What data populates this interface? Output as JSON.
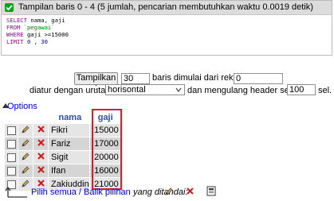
{
  "status": {
    "message": "Tampilan baris 0 - 4 (5 jumlah, pencarian membutuhkan waktu 0.0019 detik)",
    "success_icon": "check-icon"
  },
  "sql": {
    "select_kw": "SELECT",
    "select_cols": " nama, gaji",
    "from_kw": "FROM",
    "from_table": " `pegawai`",
    "where_kw": "WHERE",
    "where_cond": " gaji >=15000",
    "limit_kw": "LIMIT",
    "limit_vals": " 0 , 30"
  },
  "controls": {
    "show_button": "Tampilkan :",
    "rows_value": "30",
    "rows_from_label": "baris dimulai dari rekord #",
    "start_value": "0",
    "order_label": "diatur dengan urutan",
    "order_selected": "horisontal",
    "repeat_label": "dan mengulang header setelah",
    "repeat_value": "100",
    "repeat_unit": "sel."
  },
  "options_link": "Options",
  "table": {
    "columns": [
      "nama",
      "gaji"
    ],
    "rows": [
      {
        "nama": "Fikri",
        "gaji": "15000"
      },
      {
        "nama": "Fariz",
        "gaji": "17000"
      },
      {
        "nama": "Sigit",
        "gaji": "20000"
      },
      {
        "nama": "Ifan",
        "gaji": "16000"
      },
      {
        "nama": "Zakiuddin",
        "gaji": "21000"
      }
    ]
  },
  "bottom": {
    "select_all_label": "Pilih semua / Balik pilihan",
    "with_selected_label": "yang ditandai:"
  },
  "colors": {
    "highlight": "#e01b24",
    "link": "#0000cc",
    "header_text": "#2c4fa8"
  }
}
